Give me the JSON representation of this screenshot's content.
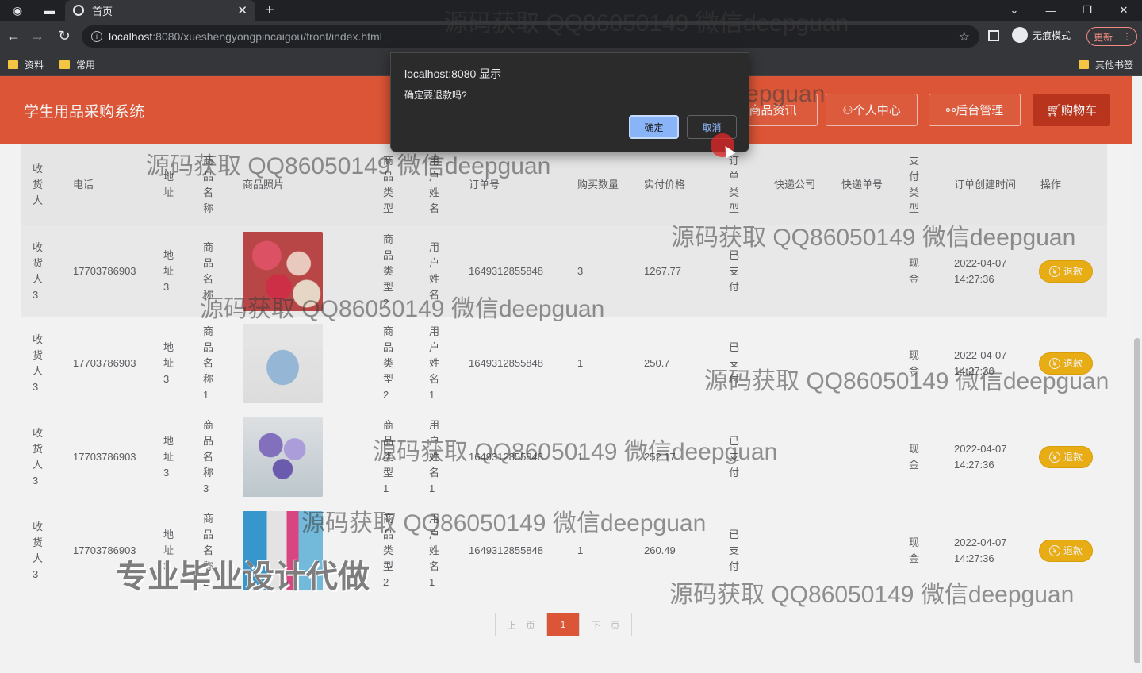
{
  "browser": {
    "tab_title": "首页",
    "url_host": "localhost",
    "url_path": ":8080/xueshengyongpincaigou/front/index.html",
    "incognito_label": "无痕模式",
    "update_label": "更新",
    "bookmarks": [
      "资料",
      "常用"
    ],
    "other_bookmarks": "其他书签"
  },
  "header": {
    "site_title": "学生用品采购系统",
    "nav": [
      "商品资讯",
      "个人中心",
      "后台管理",
      "购物车"
    ]
  },
  "table": {
    "columns": {
      "receiver": "收货人",
      "phone": "电话",
      "address": "地址",
      "product_name": "商品名称",
      "product_photo": "商品照片",
      "product_type": "商品类型",
      "user_name": "用户姓名",
      "order_no": "订单号",
      "quantity": "购买数量",
      "price": "实付价格",
      "order_type": "订单类型",
      "courier": "快递公司",
      "tracking": "快递单号",
      "pay_type": "支付类型",
      "created": "订单创建时间",
      "action": "操作"
    },
    "rows": [
      {
        "receiver": "收货人3",
        "phone": "17703786903",
        "address": "地址3",
        "product_name": "商品名称",
        "product_type": "商品类型2",
        "user_name": "用户姓名",
        "order_no": "1649312855848",
        "quantity": "3",
        "price": "1267.77",
        "order_type": "已支付",
        "courier": "",
        "tracking": "",
        "pay_type": "现金",
        "created_date": "2022-04-07",
        "created_time": "14:27:36",
        "action": "退款"
      },
      {
        "receiver": "收货人3",
        "phone": "17703786903",
        "address": "地址3",
        "product_name": "商品名称1",
        "product_type": "商品类型2",
        "user_name": "用户姓名1",
        "order_no": "1649312855848",
        "quantity": "1",
        "price": "250.7",
        "order_type": "已支付",
        "courier": "",
        "tracking": "",
        "pay_type": "现金",
        "created_date": "2022-04-07",
        "created_time": "14:27:36",
        "action": "退款"
      },
      {
        "receiver": "收货人3",
        "phone": "17703786903",
        "address": "地址3",
        "product_name": "商品名称3",
        "product_type": "商品类型1",
        "user_name": "用户姓名1",
        "order_no": "1649312855848",
        "quantity": "1",
        "price": "252.17",
        "order_type": "已支付",
        "courier": "",
        "tracking": "",
        "pay_type": "现金",
        "created_date": "2022-04-07",
        "created_time": "14:27:36",
        "action": "退款"
      },
      {
        "receiver": "收货人3",
        "phone": "17703786903",
        "address": "地址3",
        "product_name": "商品名称2",
        "product_type": "商品类型2",
        "user_name": "用户姓名1",
        "order_no": "1649312855848",
        "quantity": "1",
        "price": "260.49",
        "order_type": "已支付",
        "courier": "",
        "tracking": "",
        "pay_type": "现金",
        "created_date": "2022-04-07",
        "created_time": "14:27:36",
        "action": "退款"
      }
    ]
  },
  "pagination": {
    "prev": "上一页",
    "current": "1",
    "next": "下一页"
  },
  "dialog": {
    "title": "localhost:8080 显示",
    "message": "确定要退款吗?",
    "ok": "确定",
    "cancel": "取消"
  },
  "watermark": {
    "text": "源码获取 QQ86050149 微信deepguan",
    "big": "专业毕业设计代做"
  },
  "colors": {
    "header": "#e95a3a",
    "cart_button": "#c2371e",
    "refund_button": "#f5b716",
    "dialog_ok": "#8ab4f8"
  }
}
